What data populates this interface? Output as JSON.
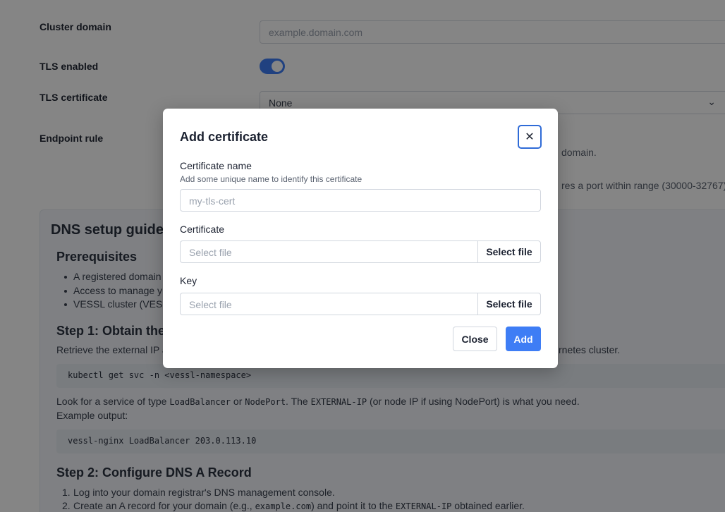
{
  "background": {
    "fields": {
      "cluster_domain_label": "Cluster domain",
      "cluster_domain_placeholder": "example.domain.com",
      "tls_enabled_label": "TLS enabled",
      "tls_enabled_value": true,
      "tls_certificate_label": "TLS certificate",
      "tls_certificate_value": "None",
      "endpoint_rule_label": "Endpoint rule",
      "endpoint_hint_1": "domain.",
      "endpoint_hint_2": "res a port within range (30000-32767)"
    },
    "guide": {
      "title": "DNS setup guide",
      "prereq_title": "Prerequisites",
      "prereq_items": [
        "A registered domain",
        "Access to manage y",
        "VESSL cluster (VESS"
      ],
      "step1_title": "Step 1: Obtain the",
      "step1_text_a": "Retrieve the external IP a",
      "step1_text_b": "rnetes cluster.",
      "step1_code": "kubectl get svc -n <vessl-namespace>",
      "lookfor": {
        "t1": "Look for a service of type ",
        "c1": "LoadBalancer",
        "t2": " or ",
        "c2": "NodePort",
        "t3": ". The ",
        "c3": "EXTERNAL-IP",
        "t4": " (or node IP if using NodePort) is what you need."
      },
      "example_output_label": "Example output:",
      "example_code": "vessl-nginx LoadBalancer 203.0.113.10",
      "step2_title": "Step 2: Configure DNS A Record",
      "step2_item1": "Log into your domain registrar's DNS management console.",
      "step2_item2": {
        "t1": "Create an A record for your domain (e.g., ",
        "c1": "example.com",
        "t2": ") and point it to the ",
        "c2": "EXTERNAL-IP",
        "t3": " obtained earlier."
      }
    }
  },
  "modal": {
    "title": "Add certificate",
    "close_icon": "close-icon",
    "certificate_name_label": "Certificate name",
    "certificate_name_help": "Add some unique name to identify this certificate",
    "certificate_name_placeholder": "my-tls-cert",
    "certificate_label": "Certificate",
    "certificate_placeholder": "Select file",
    "certificate_button": "Select file",
    "key_label": "Key",
    "key_placeholder": "Select file",
    "key_button": "Select file",
    "close_button": "Close",
    "add_button": "Add"
  },
  "colors": {
    "accent": "#3e7df5",
    "overlay": "rgba(0,0,0,0.48)"
  }
}
